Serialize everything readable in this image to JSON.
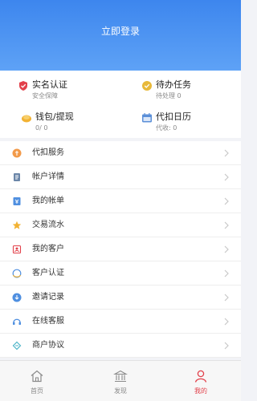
{
  "header": {
    "login_label": "立即登录",
    "color_top": "#3d86ee",
    "color_bottom": "#5ea2f6"
  },
  "stats": [
    {
      "title": "实名认证",
      "sub": "安全保障",
      "icon": "verified-shield-icon",
      "color": "#e2414b"
    },
    {
      "title": "待办任务",
      "sub": "待处理 0",
      "icon": "task-icon",
      "color": "#e8b93a"
    },
    {
      "title": "钱包/提现",
      "sub": "0/ 0",
      "icon": "wallet-icon",
      "color": "#f2b233"
    },
    {
      "title": "代扣日历",
      "sub": "代收: 0",
      "icon": "calendar-icon",
      "color": "#5b8fd8"
    }
  ],
  "menu": [
    {
      "label": "代扣服务",
      "icon": "service-icon",
      "color": "#f29a4a"
    },
    {
      "label": "帐户详情",
      "icon": "account-doc-icon",
      "color": "#6b86a8"
    },
    {
      "label": "我的帐单",
      "icon": "bill-icon",
      "color": "#4f8fe0"
    },
    {
      "label": "交易流水",
      "icon": "star-icon",
      "color": "#f2b233"
    },
    {
      "label": "我的客户",
      "icon": "customer-icon",
      "color": "#e2414b"
    },
    {
      "label": "客户认证",
      "icon": "certify-icon",
      "color": "#4f8fe0"
    },
    {
      "label": "邀请记录",
      "icon": "invite-icon",
      "color": "#4f8fe0"
    },
    {
      "label": "在线客服",
      "icon": "headset-icon",
      "color": "#4f8fe0"
    },
    {
      "label": "商户协议",
      "icon": "agreement-icon",
      "color": "#4fb6c8"
    }
  ],
  "tabs": [
    {
      "label": "首页",
      "icon": "home-icon"
    },
    {
      "label": "发现",
      "icon": "discover-icon"
    },
    {
      "label": "我的",
      "icon": "profile-icon",
      "active": true
    }
  ],
  "colors": {
    "accent": "#e2414b",
    "chevron": "#c8c8c8",
    "tab_inactive": "#8a8a8a"
  }
}
